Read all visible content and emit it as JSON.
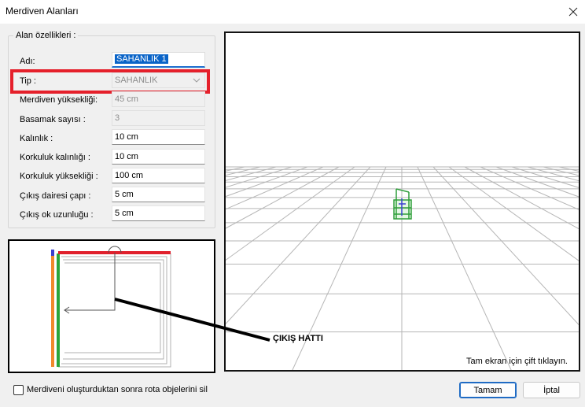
{
  "window": {
    "title": "Merdiven Alanları",
    "close_icon": "close-icon"
  },
  "properties": {
    "legend": "Alan özellikleri :",
    "name_label": "Adı:",
    "name_value": "SAHANLIK 1",
    "type_label": "Tip :",
    "type_value": "SAHANLIK",
    "stair_height_label": "Merdiven yüksekliği:",
    "stair_height_value": "45 cm",
    "step_count_label": "Basamak sayısı :",
    "step_count_value": "3",
    "thickness_label": "Kalınlık :",
    "thickness_value": "10 cm",
    "rail_thickness_label": "Korkuluk kalınlığı :",
    "rail_thickness_value": "10 cm",
    "rail_height_label": "Korkuluk yüksekliği :",
    "rail_height_value": "100 cm",
    "exit_circle_label": "Çıkış dairesi çapı :",
    "exit_circle_value": "5 cm",
    "exit_arrow_label": "Çıkış ok uzunluğu :",
    "exit_arrow_value": "5 cm"
  },
  "annotation": {
    "exit_line_label": "ÇIKIŞ HATTI"
  },
  "viewport": {
    "hint": "Tam ekran için çift tıklayın."
  },
  "footer": {
    "checkbox_label": "Merdiveni oluşturduktan sonra rota objelerini sil",
    "checkbox_checked": false,
    "ok_label": "Tamam",
    "cancel_label": "İptal"
  },
  "colors": {
    "highlight_red": "#e5202b",
    "selection_blue": "#0a64c8",
    "plan_red": "#e0202c",
    "plan_green": "#2aa53a",
    "plan_orange": "#f08a2c",
    "plan_blue": "#3b3fd0",
    "model_green": "#2e9e3a"
  }
}
